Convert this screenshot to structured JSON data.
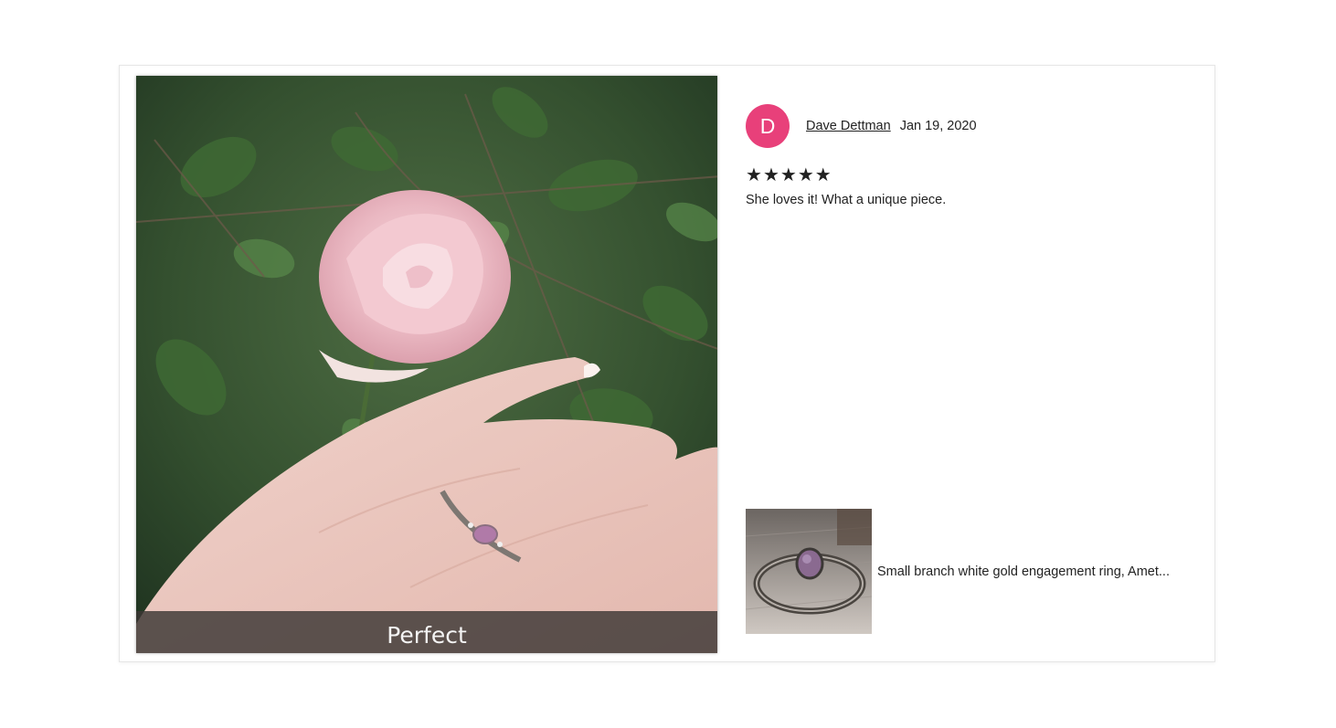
{
  "review_photo": {
    "caption": "Perfect"
  },
  "reviewer": {
    "initial": "D",
    "name": "Dave Dettman",
    "date": "Jan 19, 2020",
    "avatar_color": "#e8407a"
  },
  "rating": {
    "value": 5,
    "max": 5,
    "stars": [
      "★",
      "★",
      "★",
      "★",
      "★"
    ]
  },
  "review_text": "She loves it! What a unique piece.",
  "product": {
    "title": "Small branch white gold engagement ring, Amet..."
  }
}
